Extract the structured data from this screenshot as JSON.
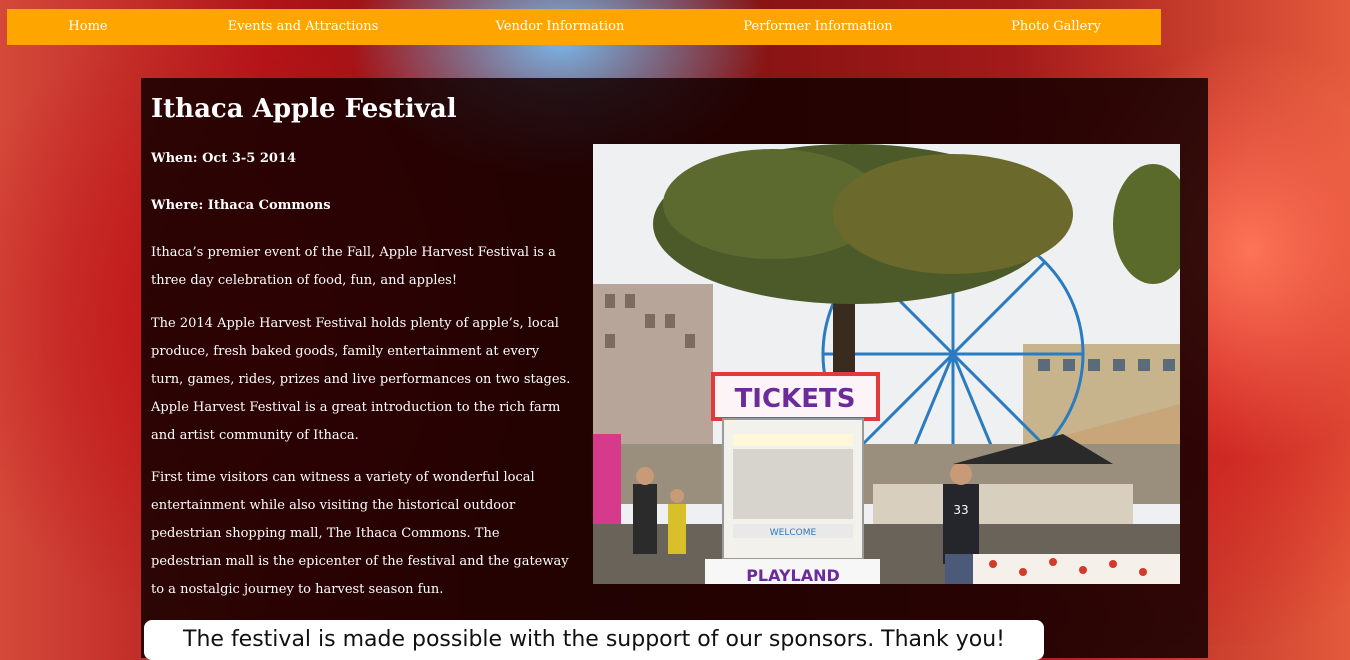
{
  "nav": {
    "items": [
      {
        "label": "Home"
      },
      {
        "label": "Events and Attractions"
      },
      {
        "label": "Vendor Information"
      },
      {
        "label": "Performer Information"
      },
      {
        "label": "Photo Gallery"
      }
    ]
  },
  "main": {
    "title": "Ithaca Apple Festival",
    "when": "When: Oct 3-5 2014",
    "where": "Where: Ithaca Commons",
    "paragraphs": [
      "Ithaca’s premier event of the Fall, Apple Harvest Festival is a three day celebration of food, fun, and apples!",
      "The 2014 Apple Harvest Festival holds plenty of apple’s, local produce, fresh baked goods, family entertainment at every turn, games, rides, prizes and live performances on two stages. Apple Harvest Festival is a great introduction to the rich farm and artist community of Ithaca.",
      "First time visitors can witness a variety of wonderful local entertainment while also visiting the historical outdoor pedestrian shopping mall, The Ithaca Commons. The pedestrian mall is the epicenter of the festival and the gateway to a nostalgic journey to harvest season fun."
    ],
    "photo": {
      "sign_text": "TICKETS",
      "booth_text": "WELCOME",
      "cart_text": "PLAYLAND",
      "shirt_number": "33"
    },
    "sponsor_text": "The festival is made possible with the support of our sponsors. Thank you!"
  },
  "colors": {
    "nav_bg": "#ffa500",
    "panel_bg": "#140000",
    "text": "#ffffff"
  }
}
